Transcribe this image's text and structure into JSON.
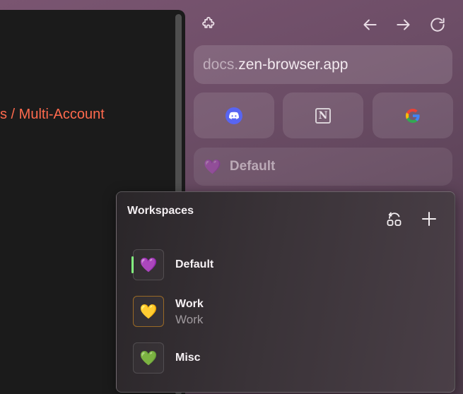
{
  "content": {
    "visible_text": "s / Multi-Account"
  },
  "toolbar": {
    "extensions_icon": "puzzle-icon",
    "back_icon": "arrow-left-icon",
    "forward_icon": "arrow-right-icon",
    "reload_icon": "reload-icon"
  },
  "urlbar": {
    "host_prefix": "docs.",
    "host_main": "zen-browser.app"
  },
  "pinned_tabs": [
    {
      "site": "Discord",
      "icon": "discord-icon",
      "color": "#5865f2"
    },
    {
      "site": "Notion",
      "icon": "notion-icon",
      "glyph": "N"
    },
    {
      "site": "Google",
      "icon": "google-icon"
    }
  ],
  "workspace_button": {
    "emoji": "💜",
    "label": "Default"
  },
  "workspaces_popup": {
    "title": "Workspaces",
    "actions": [
      {
        "icon": "manage-workspaces-icon"
      },
      {
        "icon": "plus-icon"
      }
    ],
    "items": [
      {
        "emoji": "💜",
        "name": "Default",
        "subtitle": "",
        "active": true
      },
      {
        "emoji": "💛",
        "name": "Work",
        "subtitle": "Work",
        "active": false
      },
      {
        "emoji": "💚",
        "name": "Misc",
        "subtitle": "",
        "active": false
      }
    ]
  },
  "colors": {
    "active_indicator": "#7ef57a",
    "link_accent": "#ff6a4d"
  }
}
